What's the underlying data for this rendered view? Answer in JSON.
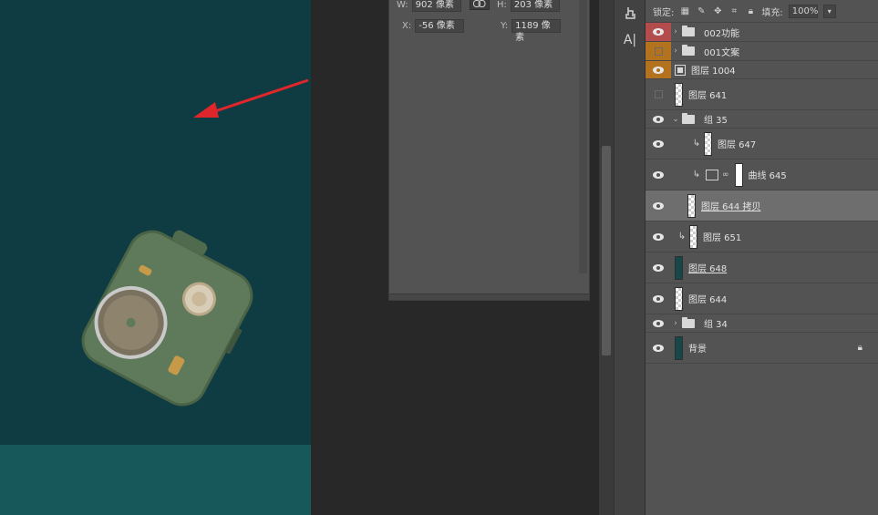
{
  "properties": {
    "w_label": "W:",
    "w_value": "902 像素",
    "h_label": "H:",
    "h_value": "203 像素",
    "x_label": "X:",
    "x_value": "-56 像素",
    "y_label": "Y:",
    "y_value": "1189 像素",
    "link_icon": "link-icon"
  },
  "tools": {
    "tool1_icon": "hand-pointer-icon",
    "tool2_label": "A|"
  },
  "layers_panel": {
    "lock_label": "锁定:",
    "fill_label": "填充:",
    "fill_value": "100%"
  },
  "layers": [
    {
      "name": "002功能",
      "type": "group",
      "visibility": "red"
    },
    {
      "name": "001文案",
      "type": "group",
      "visibility": "orange-hidden"
    },
    {
      "name": "图层 1004",
      "type": "smart",
      "visibility": "orange"
    },
    {
      "name": "图层 641",
      "type": "pixel",
      "visibility": "hidden"
    },
    {
      "name": "组 35",
      "type": "group-open",
      "visibility": "visible"
    },
    {
      "name": "图层 647",
      "type": "pixel",
      "visibility": "visible"
    },
    {
      "name": "曲线 645",
      "type": "adjustment",
      "visibility": "visible"
    },
    {
      "name": "图层 644 拷贝",
      "type": "pixel",
      "visibility": "visible",
      "selected": true
    },
    {
      "name": "图层 651",
      "type": "pixel",
      "visibility": "visible"
    },
    {
      "name": "图层 648",
      "type": "pixel",
      "visibility": "visible"
    },
    {
      "name": "图层 644",
      "type": "pixel",
      "visibility": "visible"
    },
    {
      "name": "组 34",
      "type": "group",
      "visibility": "visible"
    },
    {
      "name": "背景",
      "type": "background",
      "visibility": "visible",
      "locked": true
    }
  ],
  "colors": {
    "canvas_bg": "#0f3c42",
    "canvas_floor": "#17595a",
    "arrow": "#e0262a",
    "device_body": "#5e7a5a",
    "panel_bg": "#535353",
    "selected_row": "#6e6e6e",
    "red_tag": "#b34d4d",
    "orange_tag": "#b3731e"
  }
}
